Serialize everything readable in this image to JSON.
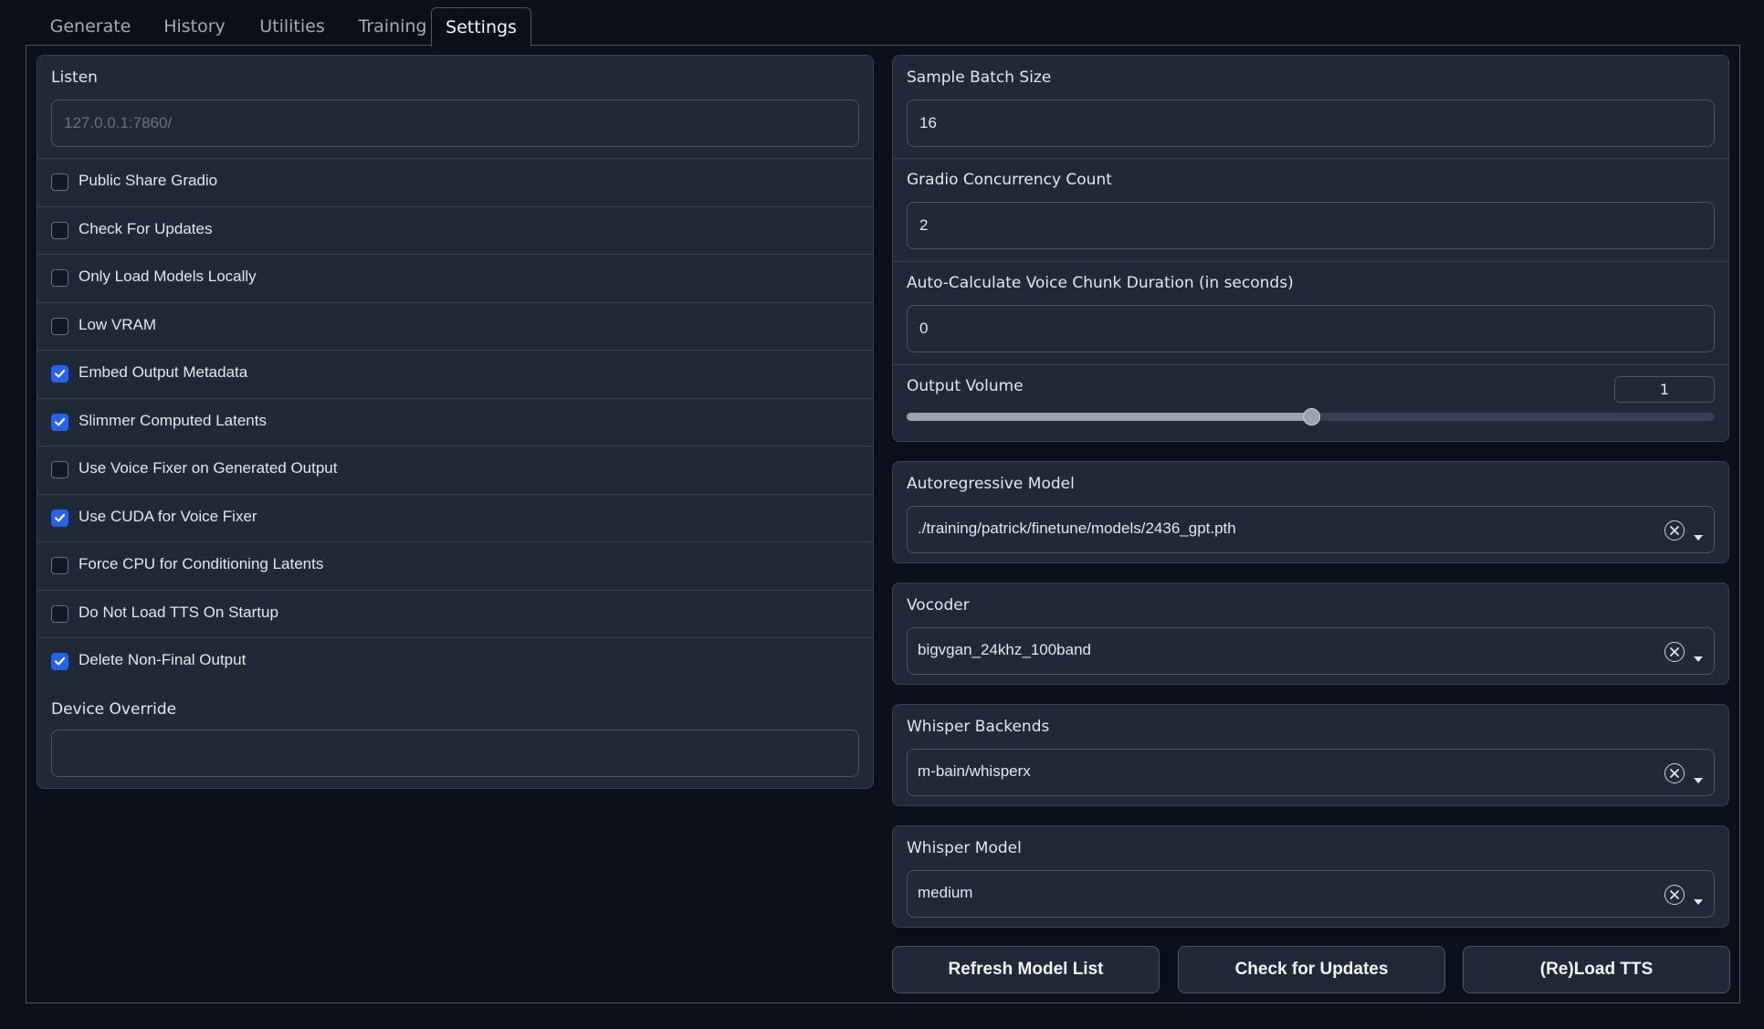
{
  "tabs": [
    {
      "label": "Generate"
    },
    {
      "label": "History"
    },
    {
      "label": "Utilities"
    },
    {
      "label": "Training"
    },
    {
      "label": "Settings"
    }
  ],
  "active_tab": "Settings",
  "left": {
    "listen": {
      "label": "Listen",
      "value": "",
      "placeholder": "127.0.0.1:7860/"
    },
    "checkboxes": [
      {
        "label": "Public Share Gradio",
        "checked": false
      },
      {
        "label": "Check For Updates",
        "checked": false
      },
      {
        "label": "Only Load Models Locally",
        "checked": false
      },
      {
        "label": "Low VRAM",
        "checked": false
      },
      {
        "label": "Embed Output Metadata",
        "checked": true
      },
      {
        "label": "Slimmer Computed Latents",
        "checked": true
      },
      {
        "label": "Use Voice Fixer on Generated Output",
        "checked": false
      },
      {
        "label": "Use CUDA for Voice Fixer",
        "checked": true
      },
      {
        "label": "Force CPU for Conditioning Latents",
        "checked": false
      },
      {
        "label": "Do Not Load TTS On Startup",
        "checked": false
      },
      {
        "label": "Delete Non-Final Output",
        "checked": true
      }
    ],
    "device_override": {
      "label": "Device Override",
      "value": ""
    }
  },
  "right": {
    "sample_batch_size": {
      "label": "Sample Batch Size",
      "value": "16"
    },
    "concurrency": {
      "label": "Gradio Concurrency Count",
      "value": "2"
    },
    "chunk_duration": {
      "label": "Auto-Calculate Voice Chunk Duration (in seconds)",
      "value": "0"
    },
    "output_volume": {
      "label": "Output Volume",
      "value": "1",
      "fraction": 0.5
    }
  },
  "dropdowns": {
    "autoregressive": {
      "label": "Autoregressive Model",
      "value": "./training/patrick/finetune/models/2436_gpt.pth"
    },
    "vocoder": {
      "label": "Vocoder",
      "value": "bigvgan_24khz_100band"
    },
    "whisper_backend": {
      "label": "Whisper Backends",
      "value": "m-bain/whisperx"
    },
    "whisper_model": {
      "label": "Whisper Model",
      "value": "medium"
    }
  },
  "buttons": {
    "refresh": "Refresh Model List",
    "check_updates": "Check for Updates",
    "reload": "(Re)Load TTS"
  },
  "icons": {
    "clear": "clear-icon",
    "dropdown": "chevron-down-icon",
    "check": "check-icon"
  },
  "colors": {
    "background": "#0b0f19",
    "panel": "#1f2937",
    "accent": "#2563eb"
  }
}
